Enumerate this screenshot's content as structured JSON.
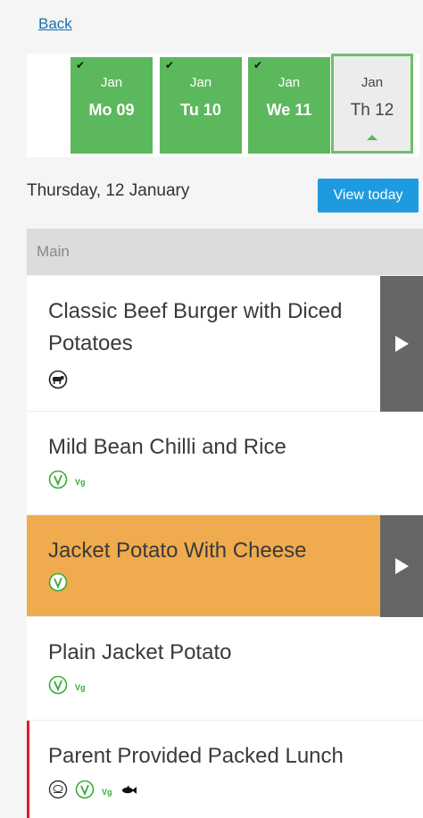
{
  "nav": {
    "back_label": "Back"
  },
  "days": [
    {
      "month": "Jan",
      "date": "Mo 09",
      "checked": true
    },
    {
      "month": "Jan",
      "date": "Tu 10",
      "checked": true
    },
    {
      "month": "Jan",
      "date": "We 11",
      "checked": true
    },
    {
      "month": "Jan",
      "date": "Th 12",
      "checked": false,
      "selected": true
    }
  ],
  "header": {
    "date_title": "Thursday, 12 January",
    "view_today_label": "View today"
  },
  "section": {
    "title": "Main"
  },
  "menu": [
    {
      "name": "Classic Beef Burger with Diced Potatoes",
      "icons": [
        "cow-icon"
      ]
    },
    {
      "name": "Mild Bean Chilli and Rice",
      "icons": [
        "vegetarian-icon"
      ],
      "tag": "Vg"
    },
    {
      "name": "Jacket Potato With Cheese",
      "icons": [
        "vegetarian-icon"
      ],
      "highlighted": true
    },
    {
      "name": "Plain Jacket Potato",
      "icons": [
        "vegetarian-icon"
      ],
      "tag": "Vg"
    },
    {
      "name": "Parent Provided Packed Lunch",
      "icons": [
        "not-halal-icon",
        "vegetarian-icon",
        "fish-icon"
      ],
      "tag": "Vg"
    }
  ],
  "colors": {
    "accent_green": "#5cb85c",
    "highlight_orange": "#efab4d",
    "button_blue": "#1e9be0",
    "alert_red": "#e21b2b"
  }
}
